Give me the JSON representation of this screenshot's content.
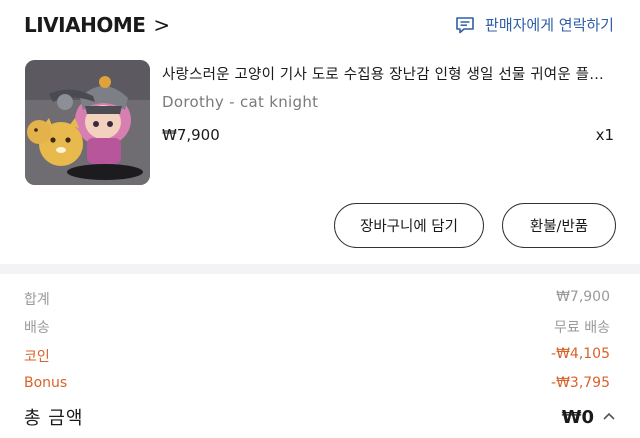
{
  "store": {
    "name": "LIVIAHOME",
    "chevron": ">"
  },
  "contact": {
    "label": "판매자에게 연락하기",
    "icon": "chat-icon"
  },
  "product": {
    "title": "사랑스러운 고양이 기사 도로 수집용 장난감 인형 생일 선물 귀여운 플러...",
    "option": "Dorothy - cat knight",
    "price": "₩7,900",
    "quantity": "x1"
  },
  "buttons": {
    "add_to_cart": "장바구니에 담기",
    "refund": "환불/반품"
  },
  "summary": {
    "subtotal": {
      "label": "합계",
      "value": "₩7,900"
    },
    "shipping": {
      "label": "배송",
      "value": "무료 배송"
    },
    "coin": {
      "label": "코인",
      "value": "-₩4,105"
    },
    "bonus": {
      "label": "Bonus",
      "value": "-₩3,795"
    },
    "total": {
      "label": "총 금액",
      "value": "₩0",
      "toggle_icon": "chevron-up-icon"
    }
  },
  "colors": {
    "link": "#2f5fa8",
    "discount": "#d9622b",
    "muted": "#9a9a9a"
  }
}
